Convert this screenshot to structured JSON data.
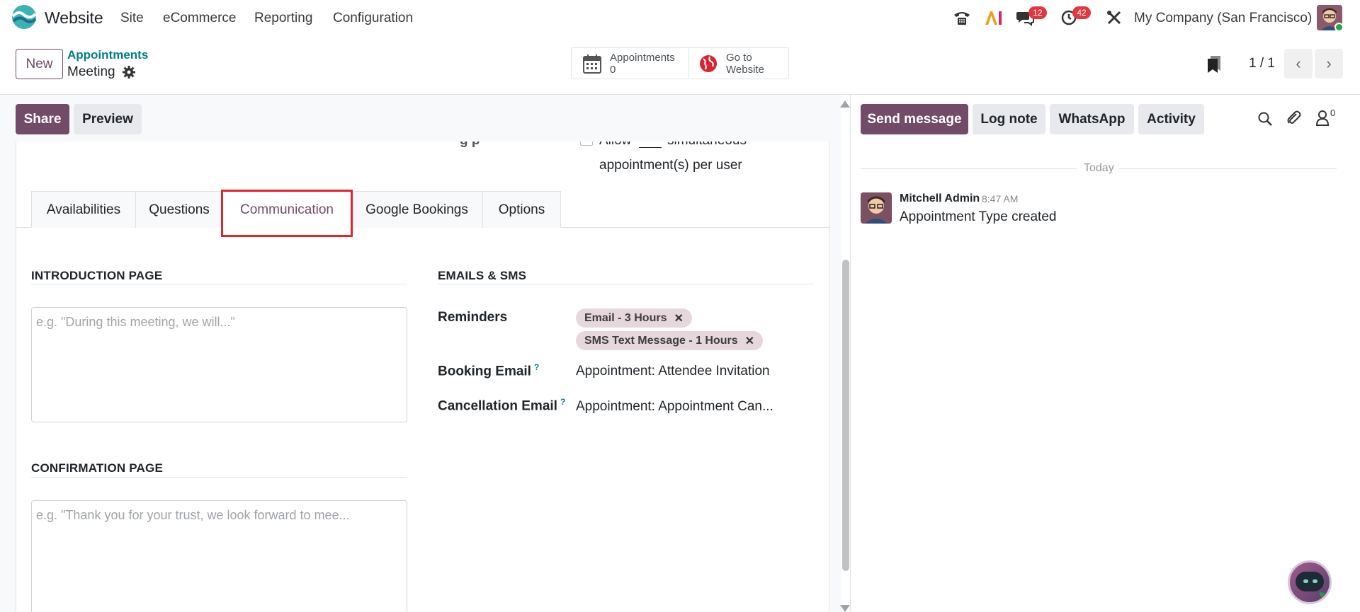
{
  "topnav": {
    "app_name": "Website",
    "menu": [
      "Site",
      "eCommerce",
      "Reporting",
      "Configuration"
    ],
    "badges": {
      "messages": "12",
      "activities": "42"
    },
    "company": "My Company (San Francisco)"
  },
  "control_panel": {
    "new_label": "New",
    "breadcrumb_parent": "Appointments",
    "breadcrumb_current": "Meeting",
    "smart_buttons": {
      "appointments_label": "Appointments",
      "appointments_count": "0",
      "website_line1": "Go to",
      "website_line2": "Website"
    },
    "pager": "1 / 1"
  },
  "statusbar": {
    "share": "Share",
    "preview": "Preview"
  },
  "form": {
    "clipped_label": "g  p",
    "clipped_allow": "Allow",
    "clipped_simultaneous": "simultaneous",
    "appointment_per_user": "appointment(s) per user",
    "tabs": [
      "Availabilities",
      "Questions",
      "Communication",
      "Google Bookings",
      "Options"
    ],
    "active_tab": "Communication",
    "intro": {
      "title": "INTRODUCTION PAGE",
      "placeholder": "e.g. \"During this meeting, we will...\""
    },
    "confirmation": {
      "title": "CONFIRMATION PAGE",
      "placeholder": "e.g. \"Thank you for your trust, we look forward to mee..."
    },
    "emails_sms": {
      "title": "EMAILS & SMS",
      "reminders_label": "Reminders",
      "reminders": [
        "Email - 3 Hours",
        "SMS Text Message - 1 Hours"
      ],
      "booking_email_label": "Booking Email",
      "booking_email_value": "Appointment: Attendee Invitation",
      "cancellation_email_label": "Cancellation Email",
      "cancellation_email_value": "Appointment: Appointment Can...",
      "help_mark": "?"
    }
  },
  "chatter": {
    "send_message": "Send message",
    "log_note": "Log note",
    "whatsapp": "WhatsApp",
    "activity": "Activity",
    "followers_count": "0",
    "date_separator": "Today",
    "message": {
      "author": "Mitchell Admin",
      "time": "8:47 AM",
      "body": "Appointment Type created"
    }
  },
  "colors": {
    "primary": "#714b67",
    "link": "#017e84",
    "highlight": "#e0262b",
    "badge": "#e0383e"
  }
}
